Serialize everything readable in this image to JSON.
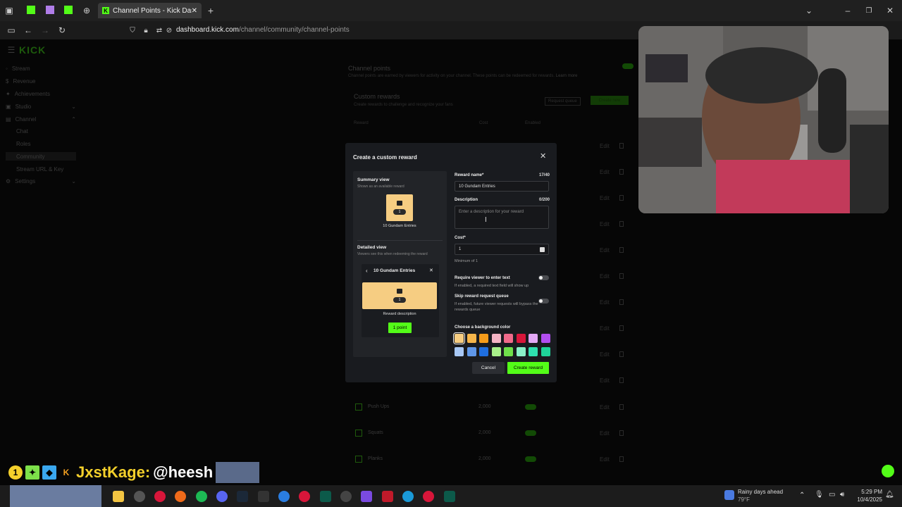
{
  "browser": {
    "tab_title": "Channel Points - Kick Dashboard",
    "url_domain": "dashboard.kick.com",
    "url_path": "/channel/community/channel-points"
  },
  "sidebar": {
    "logo": "KICK",
    "items": [
      {
        "label": "Stream",
        "icon": "broadcast-icon"
      },
      {
        "label": "Revenue",
        "icon": "dollar-icon"
      },
      {
        "label": "Achievements",
        "icon": "trophy-icon"
      },
      {
        "label": "Studio",
        "icon": "studio-icon"
      },
      {
        "label": "Channel",
        "icon": "channel-icon"
      },
      {
        "label": "Chat"
      },
      {
        "label": "Roles"
      },
      {
        "label": "Community"
      },
      {
        "label": "Stream URL & Key"
      },
      {
        "label": "Settings",
        "icon": "gear-icon"
      }
    ]
  },
  "main": {
    "title": "Channel points",
    "subtitle": "Channel points are earned by viewers for activity on your channel. These points can be redeemed for rewards.",
    "learn_more": "Learn more",
    "custom_rewards_title": "Custom rewards",
    "custom_rewards_sub": "Create rewards to challenge and recognize your fans",
    "request_queue": "Request queue",
    "create_new": "Create new",
    "col_reward": "Reward",
    "col_cost": "Cost",
    "col_enabled": "Enabled",
    "edit_label": "Edit",
    "rows": [
      {
        "name": "Push Ups",
        "cost": "2,000"
      },
      {
        "name": "Squats",
        "cost": "2,000"
      },
      {
        "name": "Planks",
        "cost": "2,000"
      }
    ]
  },
  "modal": {
    "title": "Create a custom reward",
    "summary_title": "Summary view",
    "summary_sub": "Shown as an available reward",
    "reward_name_preview": "10 Gundam Entries",
    "cost_preview": "1",
    "detailed_title": "Detailed view",
    "detailed_sub": "Viewers see this when redeeming the reward",
    "reward_description_label": "Reward description",
    "point_button": "1 point",
    "reward_name_label": "Reward name*",
    "reward_name_count": "17/40",
    "reward_name_value": "10 Gundam Entries",
    "description_label": "Description",
    "description_count": "0/200",
    "description_placeholder": "Enter a description for your reward",
    "cost_label": "Cost*",
    "cost_value": "1",
    "cost_hint": "Minimum of 1",
    "require_text_label": "Require viewer to enter text",
    "require_text_hint": "If enabled, a required text field will show up",
    "skip_queue_label": "Skip reward request queue",
    "skip_queue_hint": "If enabled, future viewer requests will bypass the rewards queue",
    "bg_color_label": "Choose a background color",
    "colors": [
      "#f6cd82",
      "#f5b54a",
      "#f59c1a",
      "#f4b4c4",
      "#f06a8a",
      "#d8163a",
      "#e3a8f5",
      "#b24ef0",
      "#a8c8f5",
      "#5f97e8",
      "#1f6fe0",
      "#a8f08a",
      "#6fe04a",
      "#8af0c8",
      "#2fe0b0",
      "#1fd49a"
    ],
    "cancel_label": "Cancel",
    "create_label": "Create reward"
  },
  "overlay": {
    "chat_user": "JxstKage:",
    "chat_message": "@heesh",
    "badge_number": "1"
  },
  "taskbar": {
    "weather": "Rainy days ahead",
    "temp": "79°F",
    "time": "5:29 PM",
    "date": "10/4/2025"
  }
}
